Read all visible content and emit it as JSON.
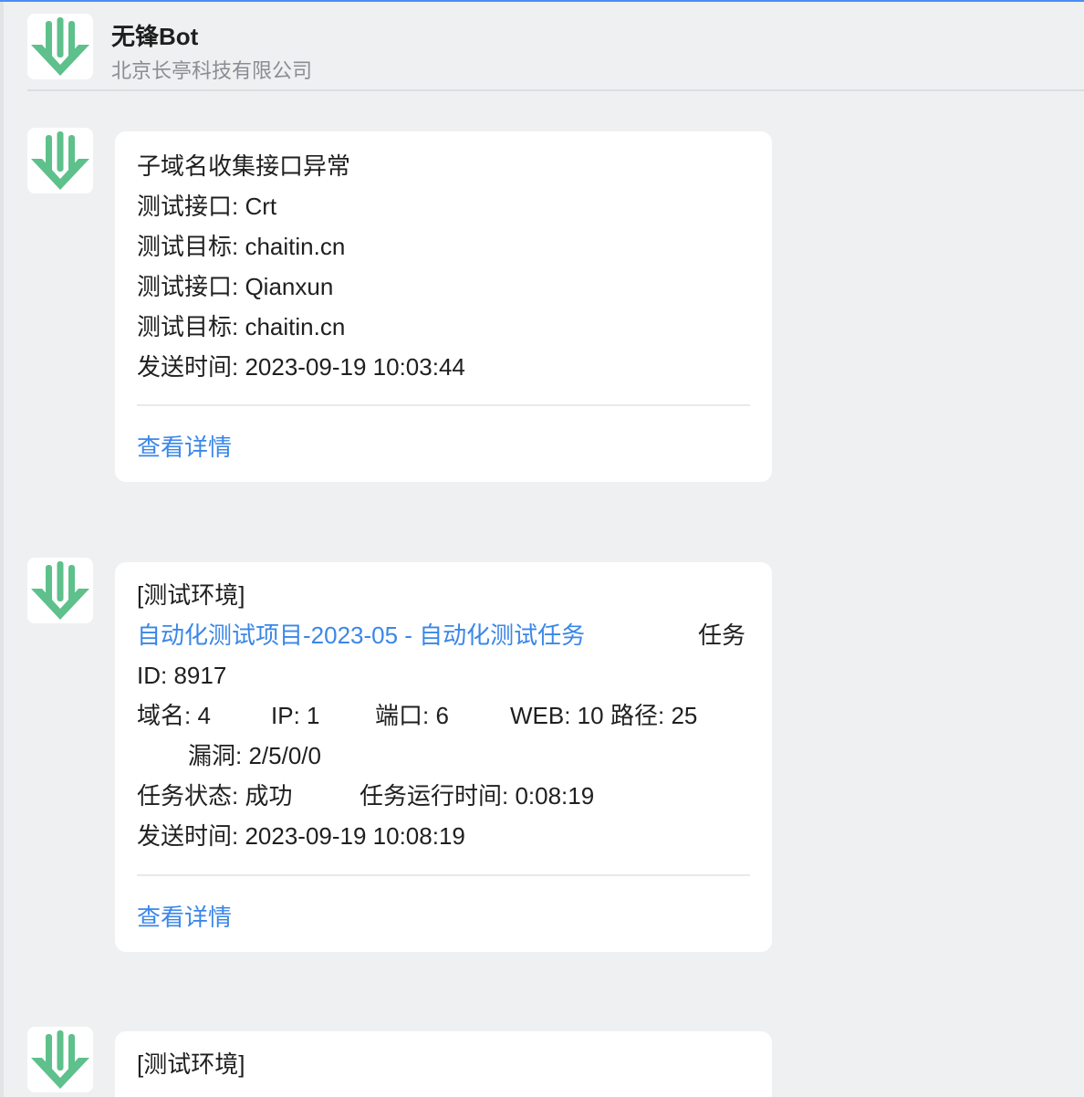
{
  "header": {
    "bot_name": "无锋Bot",
    "company": "北京长亭科技有限公司"
  },
  "messages": [
    {
      "title": "子域名收集接口异常",
      "lines": [
        "测试接口: Crt",
        "测试目标: chaitin.cn",
        "测试接口: Qianxun",
        "测试目标: chaitin.cn",
        "发送时间: 2023-09-19 10:03:44"
      ],
      "link_label": "查看详情"
    },
    {
      "title": "[测试环境]",
      "project_link": "自动化测试项目-2023-05 - 自动化测试任务",
      "task_label": "任务",
      "task_id": "ID: 8917",
      "domains": "域名: 4",
      "ip": "IP: 1",
      "ports": "端口: 6",
      "web": "WEB: 10",
      "paths": "路径: 25",
      "vulns": "漏洞: 2/5/0/0",
      "task_status": "任务状态: 成功",
      "task_runtime": "任务运行时间: 0:08:19",
      "sent_time": "发送时间: 2023-09-19 10:08:19",
      "link_label": "查看详情"
    },
    {
      "title": "[测试环境]"
    }
  ],
  "colors": {
    "accent_link": "#3a87e8",
    "logo_green": "#5ec08b",
    "top_line": "#4a8ef5"
  },
  "icons": {
    "bot_avatar": "wufeng-logo-icon"
  }
}
